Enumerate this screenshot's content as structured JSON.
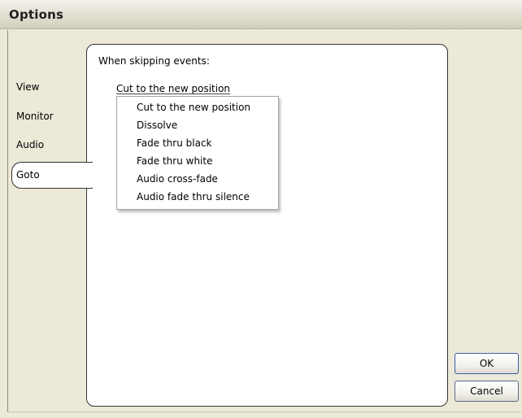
{
  "window": {
    "title": "Options"
  },
  "tabs": {
    "items": [
      {
        "label": "View"
      },
      {
        "label": "Monitor"
      },
      {
        "label": "Audio"
      },
      {
        "label": "Goto"
      }
    ],
    "selected": "Goto"
  },
  "goto_panel": {
    "section_label": "When skipping events:",
    "dropdown": {
      "selected": "Cut to the new position",
      "options": [
        "Cut to the new position",
        "Dissolve",
        "Fade thru black",
        "Fade thru white",
        "Audio cross-fade",
        "Audio fade thru silence"
      ]
    }
  },
  "buttons": {
    "ok": "OK",
    "cancel": "Cancel"
  },
  "colors": {
    "panel_background": "#ffffff",
    "dialog_background": "#ece9d8",
    "button_border": "#3d5ea8"
  }
}
